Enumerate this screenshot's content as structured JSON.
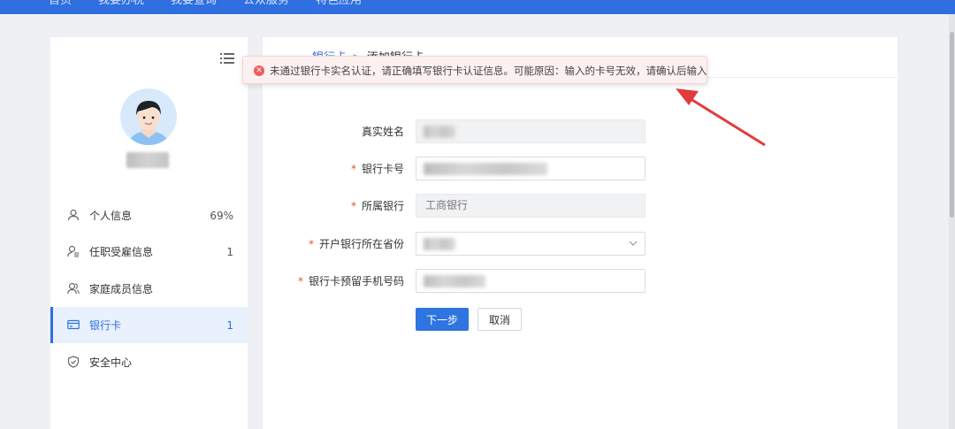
{
  "topnav": {
    "items": [
      "首页",
      "我要办税",
      "我要查询",
      "公众服务",
      "特色应用"
    ]
  },
  "sidebar": {
    "items": [
      {
        "label": "个人信息",
        "count": "69%",
        "icon": "person-icon"
      },
      {
        "label": "任职受雇信息",
        "count": "1",
        "icon": "person-list-icon"
      },
      {
        "label": "家庭成员信息",
        "count": "",
        "icon": "family-icon"
      },
      {
        "label": "银行卡",
        "count": "1",
        "icon": "bank-card-icon"
      },
      {
        "label": "安全中心",
        "count": "",
        "icon": "shield-icon"
      }
    ],
    "active_item": "银行卡"
  },
  "breadcrumb": {
    "parent": "银行卡",
    "separator": ">",
    "current": "添加银行卡"
  },
  "toast": {
    "type": "error",
    "message": "未通过银行卡实名认证，请正确填写银行卡认证信息。可能原因：输入的卡号无效，请确认后输入"
  },
  "form": {
    "fields": [
      {
        "label": "真实姓名",
        "required": false,
        "value": "",
        "disabled": true
      },
      {
        "label": "银行卡号",
        "required": true,
        "value": "",
        "disabled": false
      },
      {
        "label": "所属银行",
        "required": true,
        "value": "工商银行",
        "disabled": true
      },
      {
        "label": "开户银行所在省份",
        "required": true,
        "value": "",
        "disabled": false,
        "type": "select"
      },
      {
        "label": "银行卡预留手机号码",
        "required": true,
        "value": "",
        "disabled": false
      }
    ],
    "required_mark": "*",
    "next_label": "下一步",
    "cancel_label": "取消"
  },
  "colors": {
    "brand": "#2f6fe0",
    "error": "#ee5b5b",
    "annotation_arrow": "#e23b3b"
  }
}
